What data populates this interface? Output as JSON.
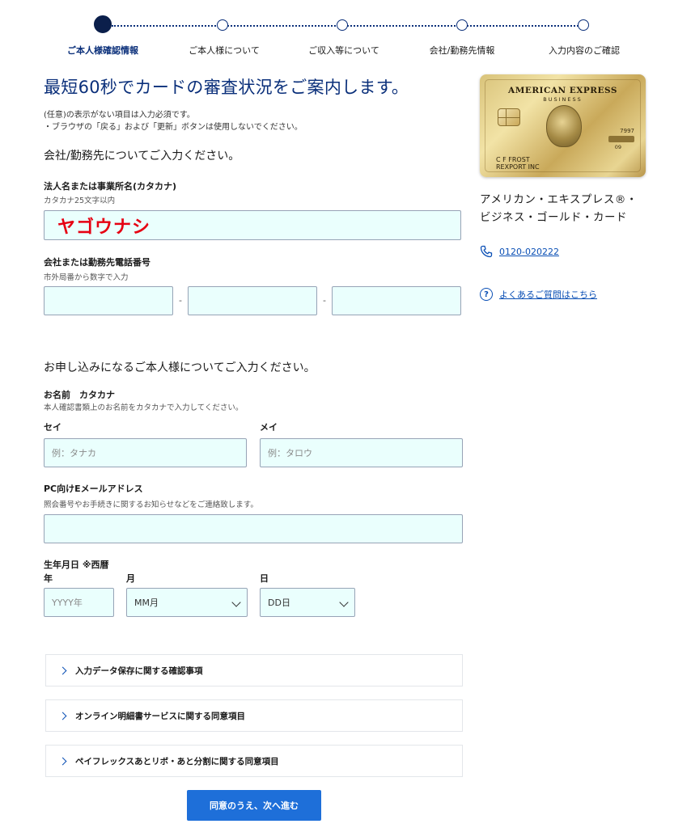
{
  "stepper": {
    "steps": [
      "ご本人様確認情報",
      "ご本人様について",
      "ご収入等について",
      "会社/勤務先情報",
      "入力内容のご確認"
    ],
    "active_index": 0
  },
  "main": {
    "headline": "最短60秒でカードの審査状況をご案内します。",
    "note_line1": "(任意)の表示がない項目は入力必須です。",
    "note_line2": "・ブラウザの「戻る」および「更新」ボタンは使用しないでください。",
    "section_company": "会社/勤務先についてご入力ください。",
    "company_name_label": "法人名または事業所名(カタカナ)",
    "company_name_hint": "カタカナ25文字以内",
    "company_name_value": "ヤゴウナシ",
    "company_phone_label": "会社または勤務先電話番号",
    "company_phone_hint": "市外局番から数字で入力",
    "phone_separator": "-",
    "section_personal": "お申し込みになるご本人様についてご入力ください。",
    "name_label": "お名前　カタカナ",
    "name_hint": "本人確認書類上のお名前をカタカナで入力してください。",
    "sei_label": "セイ",
    "sei_placeholder": "例：タナカ",
    "mei_label": "メイ",
    "mei_placeholder": "例：タロウ",
    "email_label": "PC向けEメールアドレス",
    "email_hint": "照会番号やお手続きに関するお知らせなどをご連絡致します。",
    "birth_label": "生年月日 ※西暦",
    "year_label": "年",
    "month_label": "月",
    "day_label": "日",
    "year_placeholder": "YYYY年",
    "month_value": "MM月",
    "day_value": "DD日"
  },
  "accordions": [
    "入力データ保存に関する確認事項",
    "オンライン明細書サービスに関する同意項目",
    "ペイフレックスあとリボ・あと分割に関する同意項目"
  ],
  "next_button": "同意のうえ、次へ進む",
  "side": {
    "card_brand": "AMERICAN EXPRESS",
    "card_sub": "BUSINESS",
    "card_number_fragment": "7997",
    "card_expiry": "09",
    "card_holder_line1": "C F FROST",
    "card_holder_line2": "REXPORT INC",
    "product_name_line1": "アメリカン・エキスプレス®・",
    "product_name_line2": "ビジネス・ゴールド・カード",
    "phone_number": "0120-020222",
    "faq_link": "よくあるご質問はこちら"
  },
  "colors": {
    "primary": "#0a2f7a",
    "button": "#1e6fd9",
    "input_bg": "#eafffd",
    "error_text": "#e60012"
  }
}
